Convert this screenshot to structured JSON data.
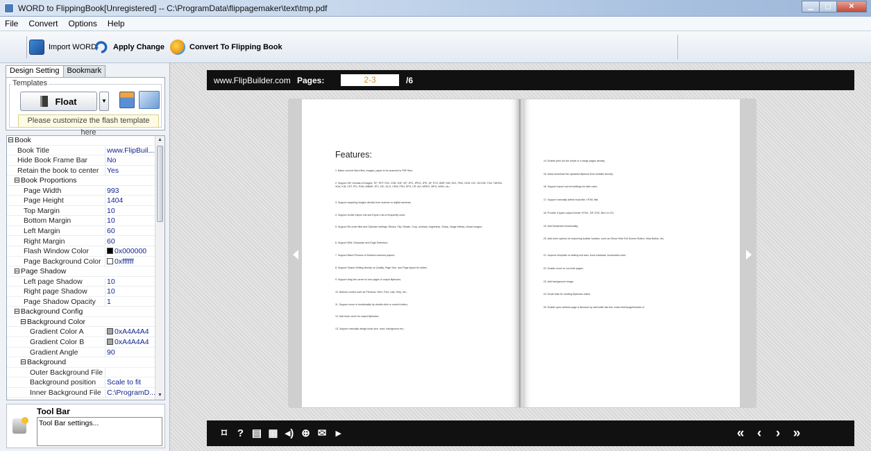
{
  "window": {
    "title": "WORD to FlippingBook[Unregistered] -- C:\\ProgramData\\flippagemaker\\text\\tmp.pdf"
  },
  "menu": {
    "file": "File",
    "convert": "Convert",
    "options": "Options",
    "help": "Help"
  },
  "toolbar": {
    "import": "Import WORD",
    "apply": "Apply Change",
    "convert": "Convert To Flipping Book"
  },
  "tabs": {
    "design": "Design Setting",
    "bookmark": "Bookmark"
  },
  "templates": {
    "label": "Templates",
    "selected": "Float",
    "customize": "Please customize the flash template here"
  },
  "props": [
    {
      "name": "Book",
      "value": "",
      "cat": true
    },
    {
      "name": "Book Title",
      "value": "www.FlipBuil..."
    },
    {
      "name": "Hide Book Frame Bar",
      "value": "No"
    },
    {
      "name": "Retain the book to center",
      "value": "Yes"
    },
    {
      "name": "Book Proportions",
      "value": "",
      "cat": true
    },
    {
      "name": "Page Width",
      "value": "993"
    },
    {
      "name": "Page Height",
      "value": "1404"
    },
    {
      "name": "Top Margin",
      "value": "10"
    },
    {
      "name": "Bottom Margin",
      "value": "10"
    },
    {
      "name": "Left Margin",
      "value": "60"
    },
    {
      "name": "Right Margin",
      "value": "60"
    },
    {
      "name": "Flash Window Color",
      "value": "0x000000",
      "color": "#000000"
    },
    {
      "name": "Page Background Color",
      "value": "0xffffff",
      "color": "#ffffff"
    },
    {
      "name": "Page Shadow",
      "value": "",
      "cat": true
    },
    {
      "name": "Left page Shadow",
      "value": "10"
    },
    {
      "name": "Right page Shadow",
      "value": "10"
    },
    {
      "name": "Page Shadow Opacity",
      "value": "1"
    },
    {
      "name": "Background Config",
      "value": "",
      "cat": true
    },
    {
      "name": "Background Color",
      "value": "",
      "cat": true
    },
    {
      "name": "Gradient Color A",
      "value": "0xA4A4A4",
      "color": "#a4a4a4"
    },
    {
      "name": "Gradient Color B",
      "value": "0xA4A4A4",
      "color": "#a4a4a4"
    },
    {
      "name": "Gradient Angle",
      "value": "90"
    },
    {
      "name": "Background",
      "value": "",
      "cat": true
    },
    {
      "name": "Outer Background File",
      "value": ""
    },
    {
      "name": "Background position",
      "value": "Scale to fit"
    },
    {
      "name": "Inner Background File",
      "value": "C:\\ProgramD..."
    }
  ],
  "toolbox": {
    "title": "Tool Bar",
    "desc": "Tool Bar settings..."
  },
  "viewer": {
    "site": "www.FlipBuilder.com",
    "pages_label": "Pages:",
    "current": "2-3",
    "total": "/6"
  },
  "left_page": {
    "heading": "Features:",
    "items": [
      "1. Batch convert Word files, images, paper to be scanned to PDF files;",
      "2. Support 35+ formats of images: TIF, TIFF, FAX, G3N, G3F, XIF, JPG, JPEG, JPE, JIF, PCX, BMP, DIB, RLE, PNG, DCM, DIC, DICOM, TGA, TARGA, VDA, ICB, VST, PIX, PXM, WBMP, JP2, J2K, DCX, CRW, PSD, EPS, CR, AVI, MPEG, MPG, WMV, etc.;",
      "3. Support acquiring images directly from scanner or digital cameras;",
      "4. Support create Import List and Export List of frequently used;",
      "5. Support Re-order files and Optimize settings: Resize, Flip, Rotate, Crop, contrast, brightness, Sharp, Image effects, reload images;",
      "6. Support B/W, Greyscale and Edge Detection;",
      "7. Support Batch Process of Deskew scanned papers;",
      "8. Support Output Setting directly on Quality, Page Size, and Page layout for slides;",
      "9. Support drag the corner to turn pages in output flipbooks;",
      "10. Buttons control such as Previous, Next, First, Last, Help, etc.;",
      "11. Support zoom in functionality by double-click or control button;",
      "12. Add book cover for output flipbooks;",
      "13. Support manually design book size, color, background etc.;"
    ]
  },
  "right_page": {
    "items": [
      "14. Enable print out the whole or a range pages directly;",
      "15. Allow download the uploaded flipbook from website directly;",
      "16. Support export current settings for later uses;",
      "17. Support manually define book title, HTML title;",
      "18. Provide 4 types output format: HTML, ZIP, EXE, Burn to CD;",
      "19. Add Bookmark functionality;",
      "20. Add more options for improving toolbar function, such as Show/ Hide Full Screen Button, Help Button, etc;",
      "21. Improve template on setting tool bars, book shadows, bookmarks color;",
      "22. Enable zoom in/ out both pages;",
      "23. Add background image;",
      "24. Email links for viewing flipbooks online;",
      "25. Enable open defined page in Browser by add suffix like this: index.html?pageNumber=4."
    ]
  },
  "controls": {
    "left": [
      {
        "glyph": "⌑",
        "name": "fullscreen-icon"
      },
      {
        "glyph": "?",
        "name": "help-icon"
      },
      {
        "glyph": "▤",
        "name": "print-icon"
      },
      {
        "glyph": "▦",
        "name": "thumbnails-icon"
      },
      {
        "glyph": "◂)",
        "name": "sound-icon"
      },
      {
        "glyph": "⊕",
        "name": "zoom-in-icon"
      },
      {
        "glyph": "✉",
        "name": "email-icon"
      },
      {
        "glyph": "▸",
        "name": "autoplay-icon"
      }
    ],
    "right": [
      {
        "glyph": "«",
        "name": "first-page-icon"
      },
      {
        "glyph": "‹",
        "name": "previous-page-icon"
      },
      {
        "glyph": "›",
        "name": "next-page-icon"
      },
      {
        "glyph": "»",
        "name": "last-page-icon"
      }
    ]
  }
}
